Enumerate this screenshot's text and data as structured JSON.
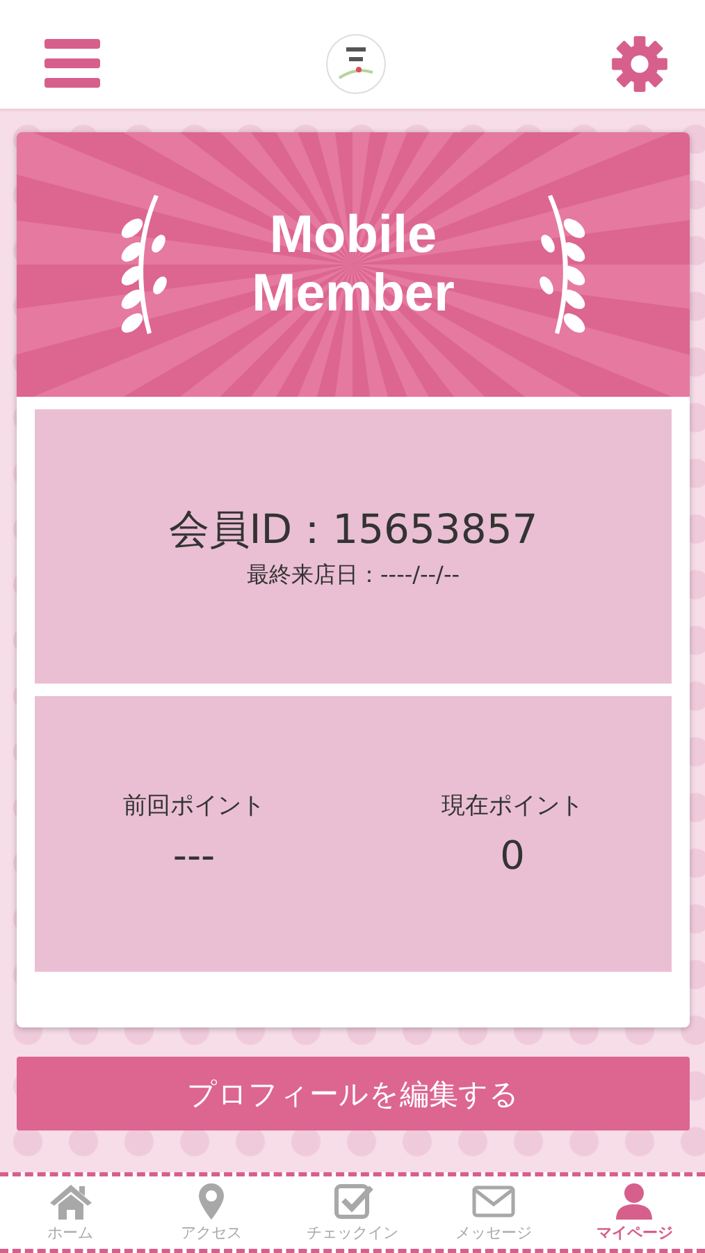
{
  "banner": {
    "title_line1": "Mobile",
    "title_line2": "Member"
  },
  "member": {
    "id_label": "会員ID：15653857",
    "last_visit": "最終来店日：----/--/--"
  },
  "points": [
    {
      "label": "前回ポイント",
      "value": "---"
    },
    {
      "label": "現在ポイント",
      "value": "0"
    }
  ],
  "edit_button": "プロフィールを編集する",
  "tabs": [
    {
      "label": "ホーム",
      "selected": false
    },
    {
      "label": "アクセス",
      "selected": false
    },
    {
      "label": "チェックイン",
      "selected": false
    },
    {
      "label": "メッセージ",
      "selected": false
    },
    {
      "label": "マイページ",
      "selected": true
    }
  ]
}
